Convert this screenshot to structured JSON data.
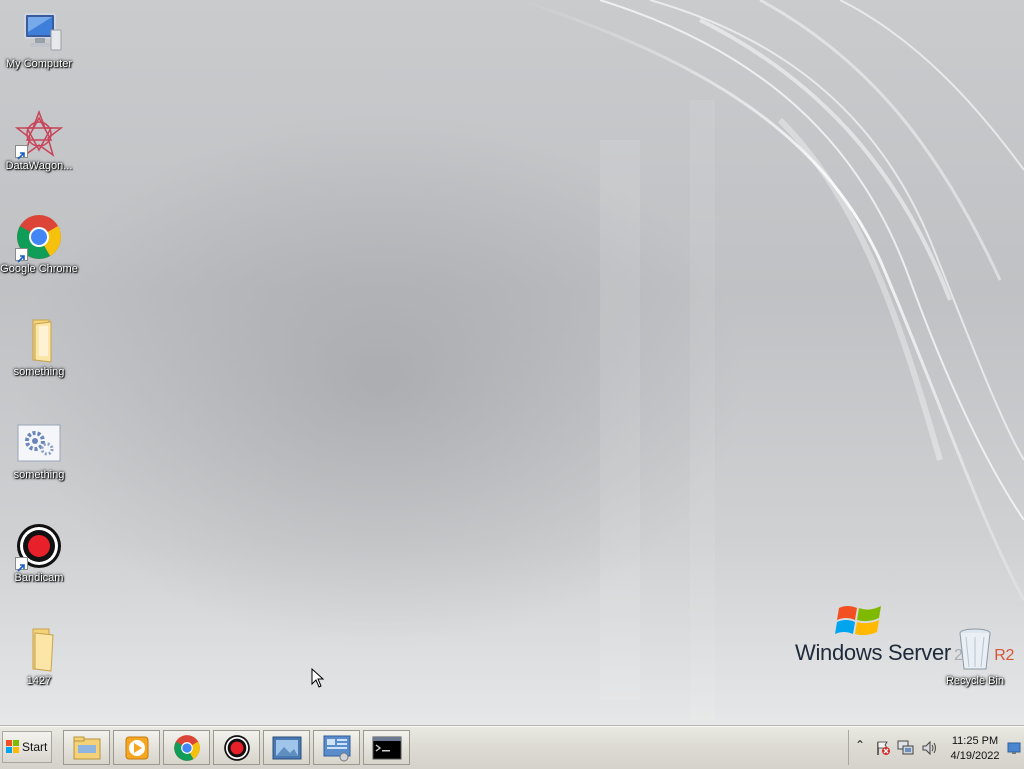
{
  "desktop": {
    "icons": [
      {
        "label": "My Computer",
        "icon": "computer-icon",
        "shortcut": false
      },
      {
        "label": "DataWagon...",
        "icon": "datawagon-icon",
        "shortcut": true
      },
      {
        "label": "Google Chrome",
        "icon": "chrome-icon",
        "shortcut": true
      },
      {
        "label": "something",
        "icon": "folder-icon",
        "shortcut": false
      },
      {
        "label": "something",
        "icon": "settings-file-icon",
        "shortcut": false
      },
      {
        "label": "Bandicam",
        "icon": "bandicam-icon",
        "shortcut": true
      },
      {
        "label": "1427",
        "icon": "folder-icon",
        "shortcut": false
      }
    ],
    "recycle_bin": {
      "label": "Recycle Bin",
      "icon": "recycle-bin-icon"
    },
    "branding": {
      "name": "Windows Server",
      "version": "2008",
      "edition": "R2"
    }
  },
  "taskbar": {
    "start_label": "Start",
    "pinned": [
      {
        "name": "explorer",
        "icon": "file-explorer-icon"
      },
      {
        "name": "media-player",
        "icon": "media-player-icon"
      },
      {
        "name": "chrome",
        "icon": "chrome-icon"
      },
      {
        "name": "bandicam",
        "icon": "bandicam-icon"
      },
      {
        "name": "image-viewer",
        "icon": "image-viewer-icon"
      },
      {
        "name": "server-manager",
        "icon": "server-manager-icon"
      },
      {
        "name": "command-prompt",
        "icon": "command-prompt-icon"
      }
    ],
    "tray": {
      "icons": [
        "action-center-icon",
        "network-icon",
        "volume-icon"
      ],
      "time": "11:25 PM",
      "date": "4/19/2022"
    }
  },
  "colors": {
    "label_text": "#ffffff",
    "taskbar_bg": "#dcdad2",
    "brand_accent": "#d8553a"
  }
}
